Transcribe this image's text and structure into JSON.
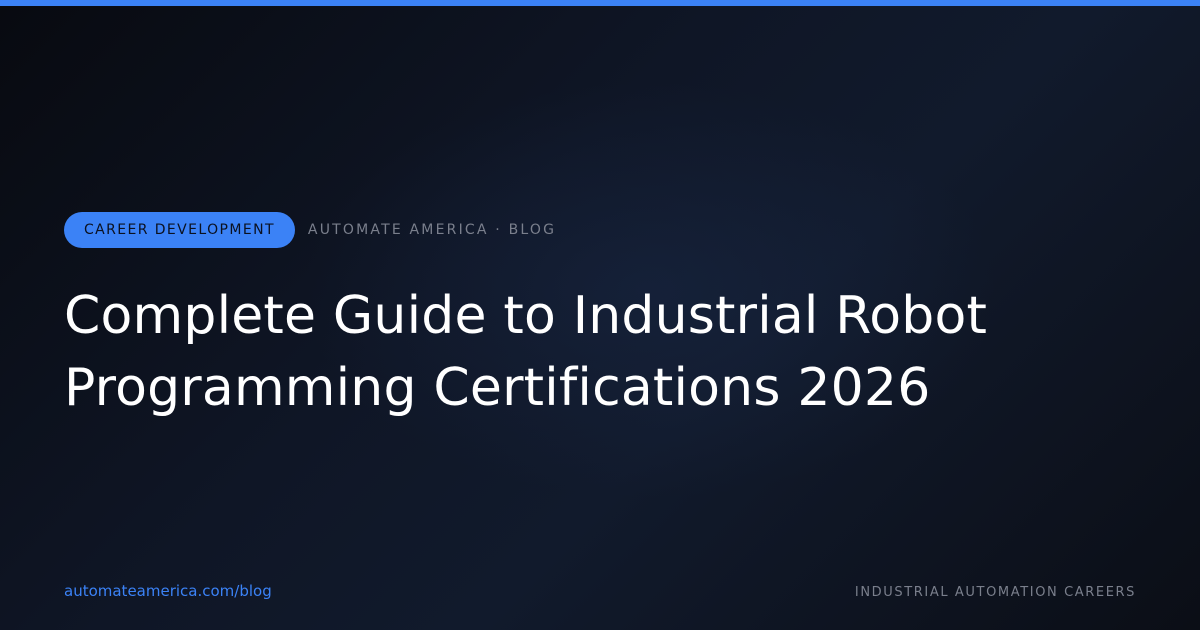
{
  "colors": {
    "accent": "#3b82f6",
    "background_dark": "#0b0e16",
    "muted_text": "#7a7f8c",
    "title_text": "#ffffff"
  },
  "category_badge": {
    "label": "CAREER DEVELOPMENT"
  },
  "site_label": "AUTOMATE AMERICA · BLOG",
  "article": {
    "title_line_1": "Complete Guide to Industrial Robot",
    "title_line_2": "Programming Certifications 2026"
  },
  "footer": {
    "url": "automateamerica.com/blog",
    "tagline": "INDUSTRIAL AUTOMATION CAREERS"
  }
}
